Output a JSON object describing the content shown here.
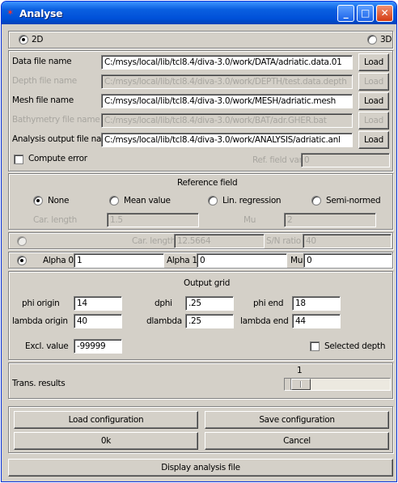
{
  "window": {
    "title": "Analyse"
  },
  "mode": {
    "opt_2d": "2D",
    "opt_3d": "3D",
    "selected": "2D"
  },
  "files": {
    "load_label": "Load",
    "data": {
      "label": "Data file name",
      "value": "C:/msys/local/lib/tcl8.4/diva-3.0/work/DATA/adriatic.data.01"
    },
    "depth": {
      "label": "Depth file name",
      "value": "C:/msys/local/lib/tcl8.4/diva-3.0/work/DEPTH/test.data.depth"
    },
    "mesh": {
      "label": "Mesh file name",
      "value": "C:/msys/local/lib/tcl8.4/diva-3.0/work/MESH/adriatic.mesh"
    },
    "bathymetry": {
      "label": "Bathymetry file name",
      "value": "C:/msys/local/lib/tcl8.4/diva-3.0/work/BAT/adr.GHER.bat"
    },
    "output": {
      "label": "Analysis output file name",
      "value": "C:/msys/local/lib/tcl8.4/diva-3.0/work/ANALYSIS/adriatic.anl"
    },
    "compute_error": "Compute error",
    "ref_field_var_label": "Ref. field var.",
    "ref_field_var_value": "0"
  },
  "reference": {
    "title": "Reference field",
    "none": "None",
    "mean": "Mean value",
    "linreg": "Lin. regression",
    "semi": "Semi-normed",
    "selected": "None",
    "car_length_label": "Car. length",
    "car_length_value": "1.5",
    "mu_label": "Mu",
    "mu_value": "2"
  },
  "params1": {
    "car_length_label": "Car. length",
    "car_length_value": "12.5664",
    "sn_label": "S/N ratio",
    "sn_value": "40"
  },
  "params2": {
    "alpha0_label": "Alpha 0",
    "alpha0_value": "1",
    "alpha1_label": "Alpha 1",
    "alpha1_value": "0",
    "mu_label": "Mu",
    "mu_value": "0"
  },
  "grid": {
    "title": "Output grid",
    "phi_origin_label": "phi origin",
    "phi_origin": "14",
    "dphi_label": "dphi",
    "dphi": ".25",
    "phi_end_label": "phi end",
    "phi_end": "18",
    "lambda_origin_label": "lambda origin",
    "lambda_origin": "40",
    "dlambda_label": "dlambda",
    "dlambda": ".25",
    "lambda_end_label": "lambda end",
    "lambda_end": "44",
    "excl_label": "Excl. value",
    "excl_value": "-99999",
    "selected_depth": "Selected depth"
  },
  "trans": {
    "label": "Trans. results",
    "value": "1",
    "level": 0.08
  },
  "actions": {
    "load_config": "Load configuration",
    "save_config": "Save configuration",
    "ok": "0k",
    "cancel": "Cancel",
    "display": "Display analysis file"
  }
}
